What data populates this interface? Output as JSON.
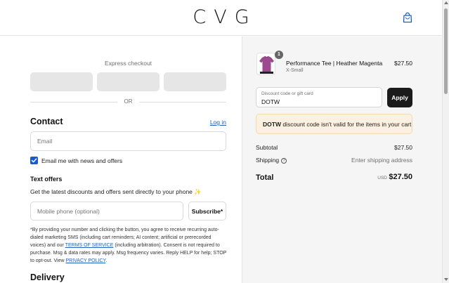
{
  "header": {
    "brand": "CVG",
    "cart_icon": "shopping-bag-icon"
  },
  "checkout": {
    "express_title": "Express checkout",
    "or_label": "OR",
    "contact": {
      "title": "Contact",
      "login_label": "Log in",
      "email_placeholder": "Email",
      "marketing_checkbox_label": "Email me with news and offers",
      "marketing_checked": true
    },
    "text_offers": {
      "title": "Text offers",
      "description": "Get the latest discounts and offers sent directly to your phone",
      "emoji": "✨",
      "phone_placeholder": "Mobile phone (optional)",
      "subscribe_label": "Subscribe*",
      "legal_part1": "*By providing your number and clicking the button, you agree to receive recurring auto-dialed marketing SMS (including cart reminders; AI content; artificial or prerecorded voices) and our ",
      "terms_link": "TERMS OF SERVICE",
      "legal_part2": " (including arbitration). Consent is not required to purchase. Msg & data rates may apply. Msg frequency varies. Reply HELP for help; STOP to opt-out. View ",
      "privacy_link": "PRIVACY POLICY",
      "legal_part3": "."
    },
    "delivery": {
      "title": "Delivery"
    }
  },
  "summary": {
    "item": {
      "name": "Performance Tee | Heather Magenta",
      "variant": "X-Small",
      "price": "$27.50",
      "quantity": "1",
      "color": "#9b4a8f"
    },
    "discount": {
      "placeholder": "Discount code or gift card",
      "value": "DOTW",
      "apply_label": "Apply"
    },
    "alert": {
      "code": "DOTW",
      "message": " discount code isn't valid for the items in your cart"
    },
    "subtotal_label": "Subtotal",
    "subtotal_value": "$27.50",
    "shipping_label": "Shipping",
    "shipping_value": "Enter shipping address",
    "total_label": "Total",
    "total_currency": "USD",
    "total_value": "$27.50"
  }
}
